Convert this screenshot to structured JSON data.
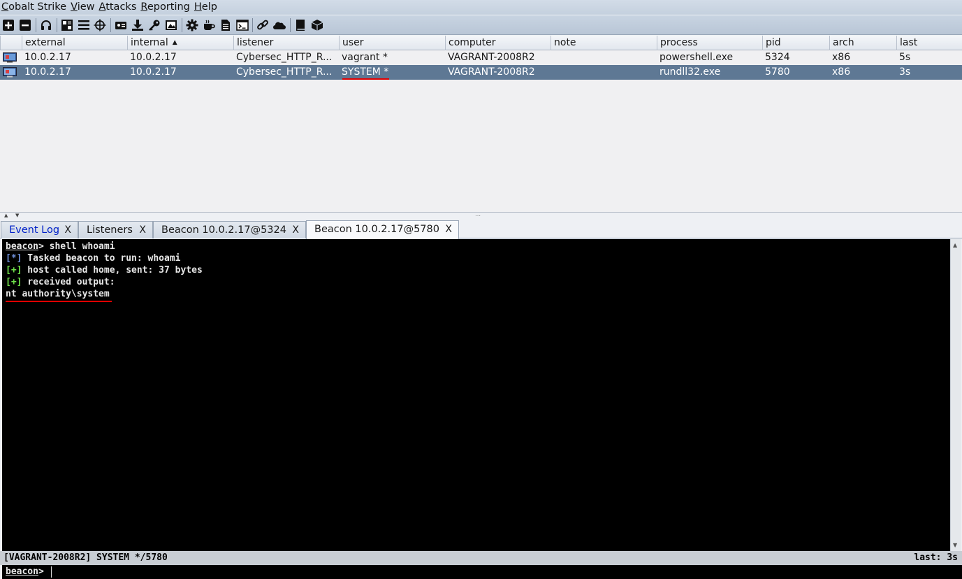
{
  "menu": [
    {
      "ul": "C",
      "rest": "obalt Strike"
    },
    {
      "ul": "V",
      "rest": "iew"
    },
    {
      "ul": "A",
      "rest": "ttacks"
    },
    {
      "ul": "R",
      "rest": "eporting"
    },
    {
      "ul": "H",
      "rest": "elp"
    }
  ],
  "toolbar_icons": [
    "plus-icon",
    "minus-icon",
    "headphones-icon",
    "pivot-graph-icon",
    "session-list-icon",
    "target-crosshair-icon",
    "credentials-icon",
    "download-icon",
    "key-icon",
    "screenshot-icon",
    "gear-icon",
    "coffee-icon",
    "document-icon",
    "console-icon",
    "link-icon",
    "cloud-icon",
    "book-icon",
    "package-icon"
  ],
  "table": {
    "headers": [
      "external",
      "internal",
      "listener",
      "user",
      "computer",
      "note",
      "process",
      "pid",
      "arch",
      "last"
    ],
    "sorted_column": "internal",
    "rows": [
      {
        "external": "10.0.2.17",
        "internal": "10.0.2.17",
        "listener": "Cybersec_HTTP_R...",
        "user": "vagrant *",
        "computer": "VAGRANT-2008R2",
        "note": "",
        "process": "powershell.exe",
        "pid": "5324",
        "arch": "x86",
        "last": "5s"
      },
      {
        "external": "10.0.2.17",
        "internal": "10.0.2.17",
        "listener": "Cybersec_HTTP_R...",
        "user": "SYSTEM *",
        "computer": "VAGRANT-2008R2",
        "note": "",
        "process": "rundll32.exe",
        "pid": "5780",
        "arch": "x86",
        "last": "3s"
      }
    ]
  },
  "tabs": [
    {
      "label": "Event Log",
      "close": "X"
    },
    {
      "label": "Listeners",
      "close": "X"
    },
    {
      "label": "Beacon 10.0.2.17@5324",
      "close": "X"
    },
    {
      "label": "Beacon 10.0.2.17@5780",
      "close": "X"
    }
  ],
  "console": {
    "prompt": "beacon",
    "command": "> shell whoami",
    "line1_tag": "[*]",
    "line1_text": " Tasked beacon to run: whoami",
    "line2_tag": "[+]",
    "line2_text": " host called home, sent: 37 bytes",
    "line3_tag": "[+]",
    "line3_text": " received output:",
    "output": "nt authority\\system"
  },
  "status": {
    "left": "[VAGRANT-2008R2] SYSTEM */5780",
    "right": "last: 3s"
  },
  "input": {
    "prompt": "beacon",
    "suffix": ">",
    "value": ""
  },
  "colors": {
    "selected_row": "#5e7894",
    "highlight_underline": "#e00000",
    "console_info": "#6f8fd8",
    "console_ok": "#6fe04a"
  }
}
